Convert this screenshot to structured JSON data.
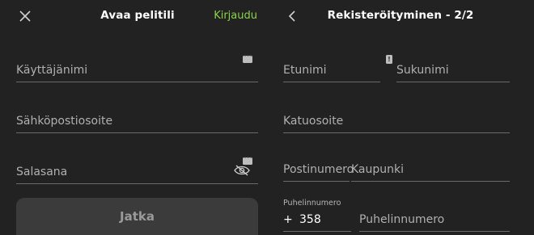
{
  "left": {
    "title": "Avaa pelitili",
    "login_link": "Kirjaudu",
    "fields": {
      "username": "Käyttäjänimi",
      "email": "Sähköpostiosoite",
      "password": "Salasana"
    },
    "submit_label": "Jatka"
  },
  "right": {
    "title": "Rekisteröityminen - 2/2",
    "fields": {
      "first_name": "Etunimi",
      "last_name": "Sukunimi",
      "street": "Katuosoite",
      "postal_code": "Postinumero",
      "city": "Kaupunki",
      "phone_caption": "Puhelinnumero",
      "phone_plus": "+",
      "phone_code": "358",
      "phone_number": "Puhelinnumero"
    }
  },
  "colors": {
    "accent": "#8ad34a",
    "background": "#222222",
    "button": "#3b3b3b"
  },
  "icons": [
    "close-icon",
    "back-icon",
    "password-manager-icon",
    "hide-password-icon",
    "alert-icon"
  ]
}
